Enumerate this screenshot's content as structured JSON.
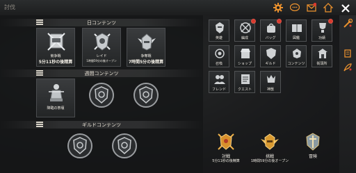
{
  "window": {
    "title": "討伐"
  },
  "sections": {
    "daily": {
      "title": "日コンテンツ"
    },
    "weekly": {
      "title": "週間コンテンツ"
    },
    "guild": {
      "title": "ギルドコンテンツ"
    }
  },
  "daily_tiles": [
    {
      "name": "競争戦",
      "sub": "5分11秒の後精算"
    },
    {
      "name": "レイド",
      "sub": "1時間59分の後オープン"
    },
    {
      "name": "争奪戦",
      "sub": "7時間5分の後精算"
    }
  ],
  "weekly_tiles": [
    {
      "name": "降臨の祭壇"
    }
  ],
  "menu": [
    {
      "name": "英雄",
      "icon": "hero-icon",
      "badge": false
    },
    {
      "name": "編成",
      "icon": "formation-icon",
      "badge": true
    },
    {
      "name": "バッグ",
      "icon": "bag-icon",
      "badge": true
    },
    {
      "name": "図鑑",
      "icon": "book-icon",
      "badge": false
    },
    {
      "name": "功績",
      "icon": "achievement-icon",
      "badge": true
    },
    {
      "name": "召喚",
      "icon": "summon-icon",
      "badge": false
    },
    {
      "name": "ショップ",
      "icon": "shop-icon",
      "badge": false
    },
    {
      "name": "ギルド",
      "icon": "guild-icon",
      "badge": false
    },
    {
      "name": "コンテンツ",
      "icon": "content-icon",
      "badge": false
    },
    {
      "name": "街頭所",
      "icon": "street-icon",
      "badge": false
    },
    {
      "name": "フレンド",
      "icon": "friend-icon",
      "badge": false
    },
    {
      "name": "クエスト",
      "icon": "quest-icon",
      "badge": false
    },
    {
      "name": "神獣",
      "icon": "beast-icon",
      "badge": false
    }
  ],
  "activities": [
    {
      "name": "対戦",
      "sub": "5分11秒の後精算"
    },
    {
      "name": "挑戦",
      "sub": "1時間59分の後オープン"
    },
    {
      "name": "冒険",
      "sub": ""
    }
  ],
  "top_icons": [
    "settings-icon",
    "chat-icon",
    "mail-icon",
    "home-icon",
    "close-icon"
  ],
  "colors": {
    "accent": "#e08a2a",
    "badge": "#d93a2e"
  }
}
